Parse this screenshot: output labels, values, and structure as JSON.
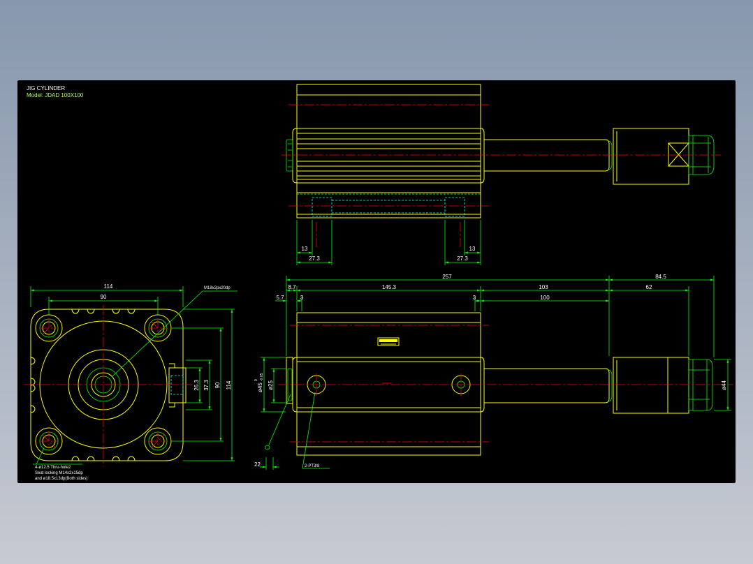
{
  "title_block": {
    "title": "JIG CYLINDER",
    "model": "Model: JDAD 100X100"
  },
  "top_view": {
    "dim_left_inner": "13",
    "dim_left_outer": "27.3",
    "dim_right_outer": "27.3",
    "dim_right_inner": "13"
  },
  "end_view": {
    "width": "114",
    "hole_pitch_horizontal": "90",
    "rod_thread_callout": "M18x2px20dp",
    "port_dim_inner": "26.3",
    "port_dim_outer": "37.3",
    "hole_pitch_vertical": "90",
    "height": "114",
    "mounting_note": [
      "4-ø12.5 Thru-hole2",
      "Seat locking  M14x2x15dp",
      "and ø18.5x13dp(Both sides)"
    ]
  },
  "front_view": {
    "overall_length": "257",
    "rod_end_length": "84.5",
    "cap_length": "8.7",
    "body_length": "145.3",
    "rod_length": "103",
    "rod_end_block_length": "62",
    "cap_offset": "5.7",
    "left_gap": "3",
    "right_gap": "3",
    "stroke": "100",
    "rod_diameter": "ø45",
    "rod_diameter_tol_upper": "0",
    "rod_diameter_tol_lower": "-0.05",
    "bore_diameter": "ø25",
    "nut_diameter": "ø44",
    "cap_dim": "22",
    "port_callout": "2-PT3/8"
  },
  "colors": {
    "background_top": "#8797ad",
    "background_bottom": "#c6cad2",
    "canvas": "#000000",
    "outline": "#ffff00",
    "dimension": "#00ff00",
    "center_line": "#ff0000",
    "hidden_line": "#00ffff",
    "text": "#ffffff",
    "model_text": "#b4ff64"
  }
}
